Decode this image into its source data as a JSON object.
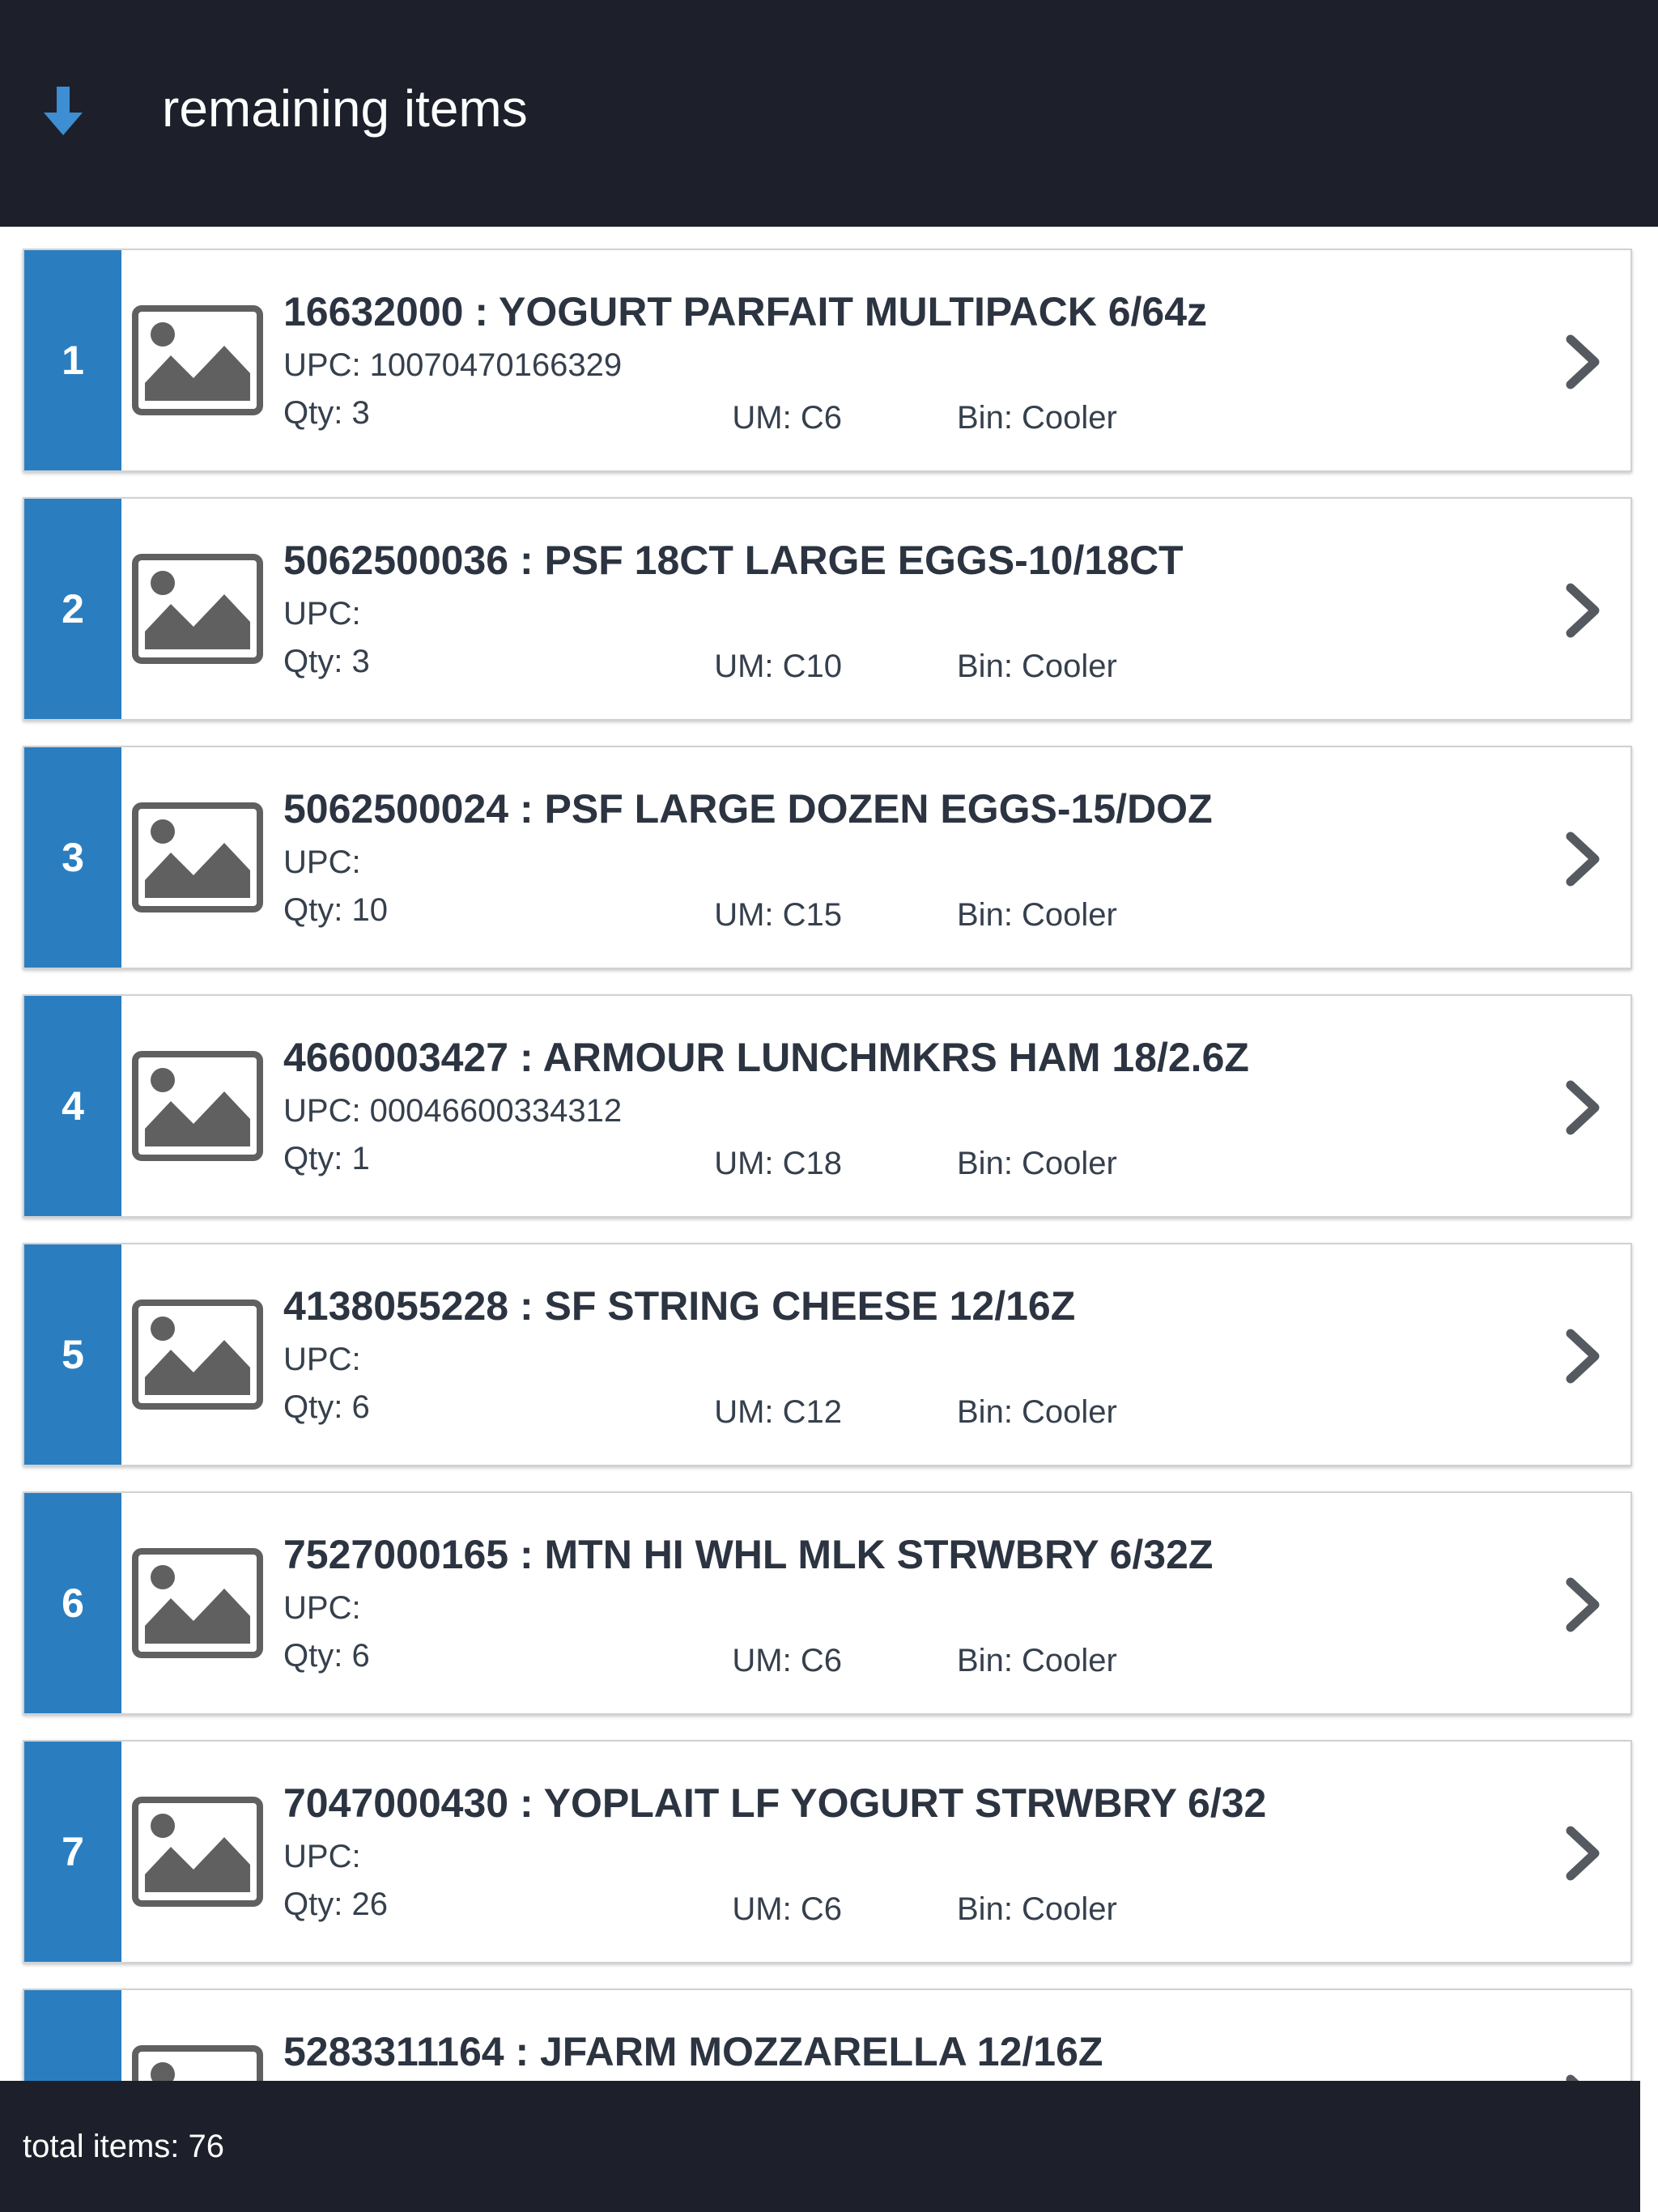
{
  "header": {
    "title": "remaining items",
    "icon": "arrow-down-icon",
    "icon_color": "#3d8ed3",
    "background": "#1d202a"
  },
  "items": [
    {
      "index": "1",
      "title": "16632000 : YOGURT PARFAIT MULTIPACK 6/64z",
      "upc": "UPC: 10070470166329",
      "qty": "Qty: 3",
      "um": "UM: C6",
      "bin": "Bin: Cooler"
    },
    {
      "index": "2",
      "title": "5062500036 : PSF 18CT LARGE EGGS-10/18CT",
      "upc": "UPC:",
      "qty": "Qty: 3",
      "um": "UM: C10",
      "bin": "Bin: Cooler"
    },
    {
      "index": "3",
      "title": "5062500024 : PSF LARGE DOZEN EGGS-15/DOZ",
      "upc": "UPC:",
      "qty": "Qty: 10",
      "um": "UM: C15",
      "bin": "Bin: Cooler"
    },
    {
      "index": "4",
      "title": "4660003427 : ARMOUR LUNCHMKRS HAM 18/2.6Z",
      "upc": "UPC: 00046600334312",
      "qty": "Qty: 1",
      "um": "UM: C18",
      "bin": "Bin: Cooler"
    },
    {
      "index": "5",
      "title": "4138055228 : SF STRING CHEESE 12/16Z",
      "upc": "UPC:",
      "qty": "Qty: 6",
      "um": "UM: C12",
      "bin": "Bin: Cooler"
    },
    {
      "index": "6",
      "title": "7527000165 : MTN HI WHL MLK STRWBRY 6/32Z",
      "upc": "UPC:",
      "qty": "Qty: 6",
      "um": "UM: C6",
      "bin": "Bin: Cooler"
    },
    {
      "index": "7",
      "title": "7047000430 : YOPLAIT LF YOGURT STRWBRY 6/32",
      "upc": "UPC:",
      "qty": "Qty: 26",
      "um": "UM: C6",
      "bin": "Bin: Cooler"
    },
    {
      "index": "",
      "title": "5283311164 : JFARM MOZZARELLA 12/16Z",
      "upc": "",
      "qty": "",
      "um": "",
      "bin": ""
    }
  ],
  "footer": {
    "total": "total items: 76"
  },
  "colors": {
    "accent": "#2a7ec0",
    "dark_bar": "#1d202a",
    "text": "#2c3441",
    "icon_gray": "#606060"
  },
  "icons": {
    "thumbnail": "image-placeholder-icon",
    "row_action": "chevron-right-icon"
  }
}
